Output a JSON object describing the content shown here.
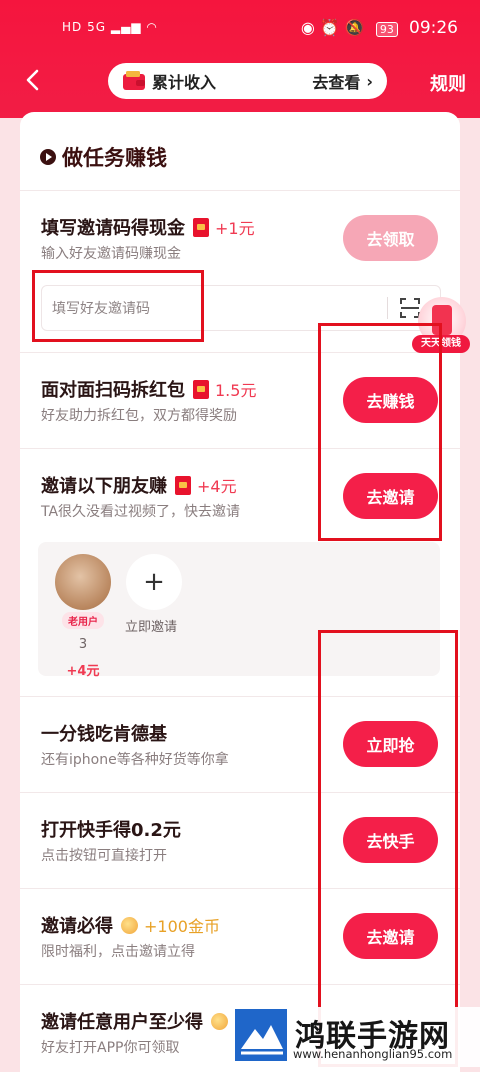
{
  "status_bar": {
    "left": "HD 5G",
    "battery": "93",
    "time": "09:26",
    "icons": [
      "eye-icon",
      "alarm-icon",
      "mute-icon"
    ]
  },
  "header": {
    "back": "‹",
    "income_label": "累计收入",
    "income_link": "去查看",
    "income_chevron": "›",
    "rules": "规则"
  },
  "section": {
    "title": "做任务赚钱"
  },
  "tasks": [
    {
      "title": "填写邀请码得现金",
      "reward": "+1元",
      "subtitle": "输入好友邀请码赚现金",
      "button": "去领取"
    },
    {
      "title": "面对面扫码拆红包",
      "reward": "1.5元",
      "subtitle": "好友助力拆红包，双方都得奖励",
      "button": "去赚钱"
    },
    {
      "title": "邀请以下朋友赚",
      "reward": "+4元",
      "subtitle": "TA很久没看过视频了，快去邀请",
      "button": "去邀请"
    },
    {
      "title": "一分钱吃肯德基",
      "reward": "",
      "subtitle": "还有iphone等各种好货等你拿",
      "button": "立即抢"
    },
    {
      "title": "打开快手得0.2元",
      "reward": "",
      "subtitle": "点击按钮可直接打开",
      "button": "去快手"
    },
    {
      "title": "邀请必得",
      "reward": "+100金币",
      "subtitle": "限时福利，点击邀请立得",
      "button": "去邀请"
    },
    {
      "title": "邀请任意用户至少得",
      "reward": "",
      "subtitle": "好友打开APP你可领取",
      "button": ""
    }
  ],
  "invite_input": {
    "placeholder": "填写好友邀请码"
  },
  "floating_badge": {
    "label": "天天领钱"
  },
  "friends": {
    "friend": {
      "tag": "老用户",
      "count": "3",
      "reward": "+4元"
    },
    "invite_label": "立即邀请",
    "plus": "+"
  },
  "watermark": {
    "title": "鸿联手游网",
    "url": "www.henanhonglian95.com"
  },
  "colors": {
    "primary": "#f41f49",
    "reward": "#f03a52",
    "annotation": "#e2101e"
  }
}
